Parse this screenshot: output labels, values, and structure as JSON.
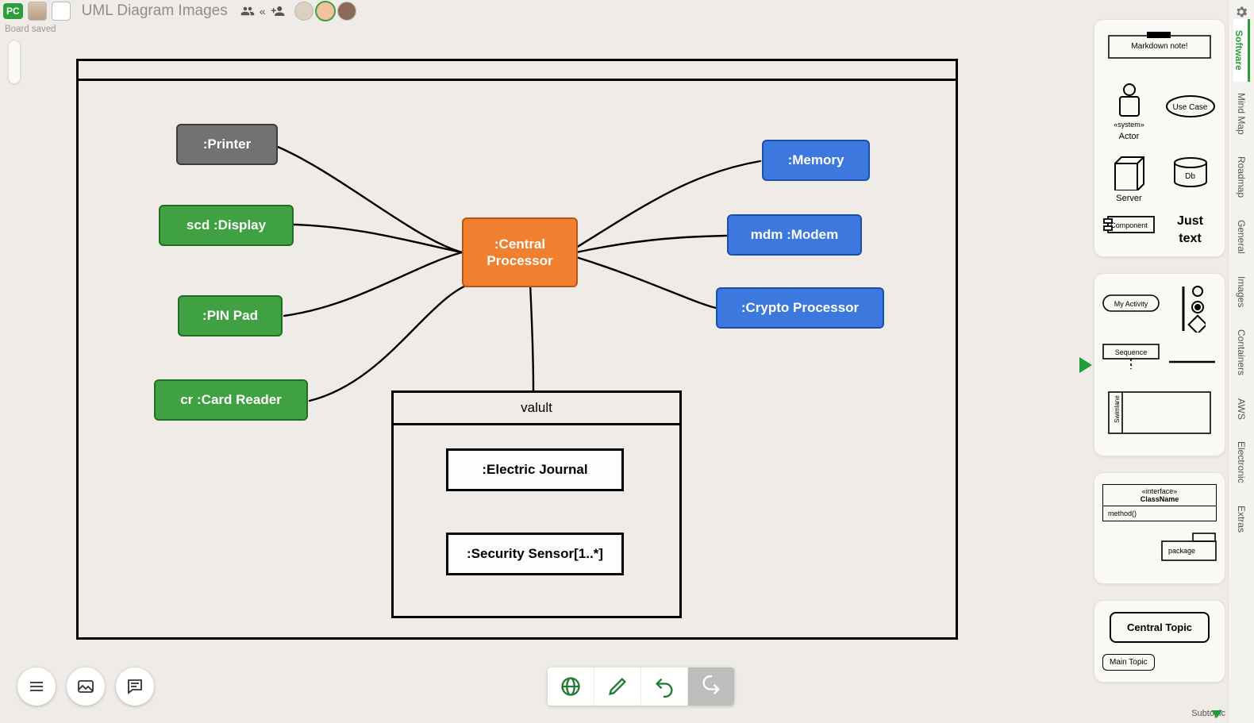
{
  "header": {
    "pc_badge": "PC",
    "title": "UML Diagram Images",
    "board_saved": "Board saved"
  },
  "nodes": {
    "printer": ":Printer",
    "display": "scd :Display",
    "pin_pad": ":PIN Pad",
    "card_reader": "cr :Card Reader",
    "central": ":Central Processor",
    "memory": ":Memory",
    "modem": "mdm :Modem",
    "crypto": ":Crypto Processor",
    "vault_title": "valult",
    "electric_journal": ":Electric Journal",
    "security_sensor": ":Security Sensor[1..*]"
  },
  "right_tabs": [
    "Software",
    "Mind Map",
    "Roadmap",
    "General",
    "Images",
    "Containers",
    "AWS",
    "Electronic",
    "Extras"
  ],
  "panel1": {
    "markdown_note": "Markdown note!",
    "use_case": "Use Case",
    "actor_stereotype": "«system»",
    "actor_label": "Actor",
    "db_label": "Db",
    "server_label": "Server",
    "component_label": "Component",
    "just_text1": "Just",
    "just_text2": "text"
  },
  "panel2": {
    "my_activity": "My Activity",
    "sequence": "Sequence",
    "swimlane": "Swimlane"
  },
  "panel3": {
    "interface_stereotype": "«interface»",
    "class_name": "ClassName",
    "method": "method()",
    "package_label": "package"
  },
  "panel4": {
    "central_topic": "Central Topic",
    "main_topic": "Main Topic"
  },
  "subtopic_label": "Subtopic"
}
